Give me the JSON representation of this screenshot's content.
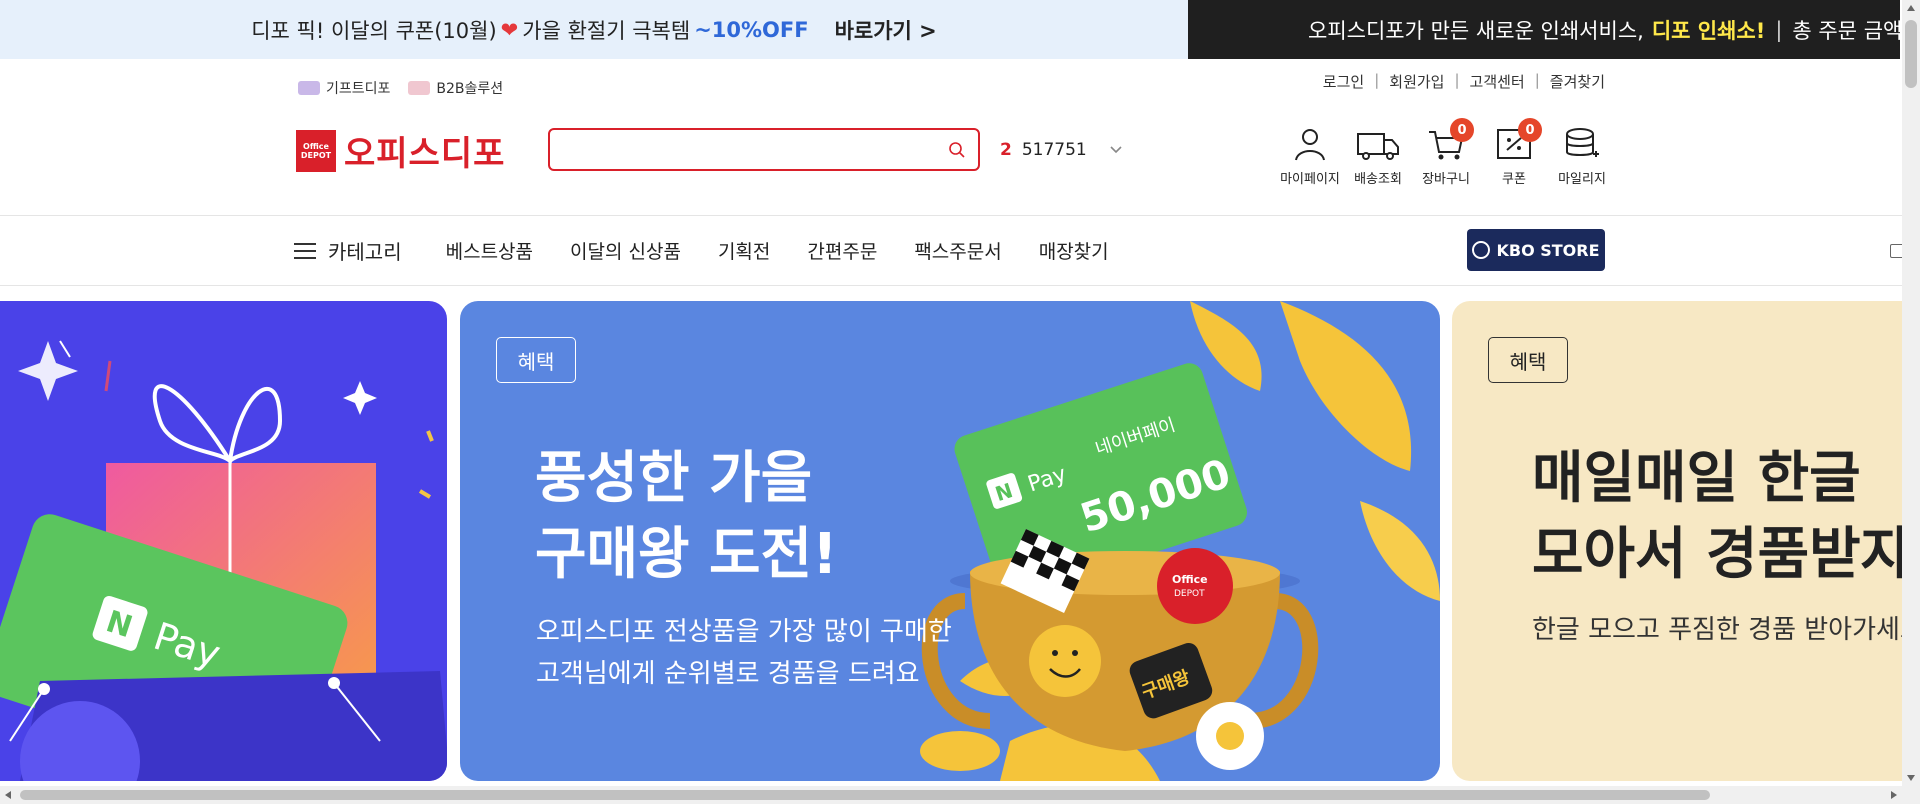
{
  "promo": {
    "left_text": "디포 픽! 이달의 쿠폰(10월)",
    "left_text2": "가을 환절기 극복템",
    "left_accent": "~10%OFF",
    "left_go": "바로가기 >",
    "right_text": "오피스디포가 만든 새로운 인쇄서비스,",
    "right_highlight": "디포 인쇄소!",
    "right_sep": "|",
    "right_tail": "총 주문 금액에 따라"
  },
  "util": {
    "gift": "기프트디포",
    "b2b": "B2B솔루션",
    "login": "로그인",
    "join": "회원가입",
    "service": "고객센터",
    "favorite": "즐겨찾기"
  },
  "header": {
    "logo_box_line1": "Office",
    "logo_box_line2": "DEPOT",
    "logo_text": "오피스디포",
    "search_placeholder": "",
    "rank_num": "2",
    "rank_value": "517751"
  },
  "icons": {
    "mypage": "마이페이지",
    "delivery": "배송조회",
    "cart": "장바구니",
    "cart_count": "0",
    "coupon": "쿠폰",
    "coupon_count": "0",
    "mileage": "마일리지"
  },
  "nav": {
    "category": "카테고리",
    "items": [
      "베스트상품",
      "이달의 신상품",
      "기획전",
      "간편주문",
      "팩스주문서",
      "매장찾기"
    ],
    "kbo": "KBO STORE"
  },
  "banners": {
    "b2": {
      "tag": "혜택",
      "head1": "풍성한 가을",
      "head2": "구매왕 도전!",
      "sub1": "오피스디포 전상품을 가장 많이 구매한",
      "sub2": "고객님에게 순위별로 경품을 드려요",
      "card_brand": "Pay",
      "card_label": "네이버페이",
      "card_amount": "50,000",
      "trophy_badge": "구매왕"
    },
    "b3": {
      "tag": "혜택",
      "head1": "매일매일 한글",
      "head2": "모아서 경품받자",
      "sub": "한글 모으고 푸짐한 경품 받아가세요"
    },
    "b1": {
      "card_brand": "Pay"
    }
  }
}
